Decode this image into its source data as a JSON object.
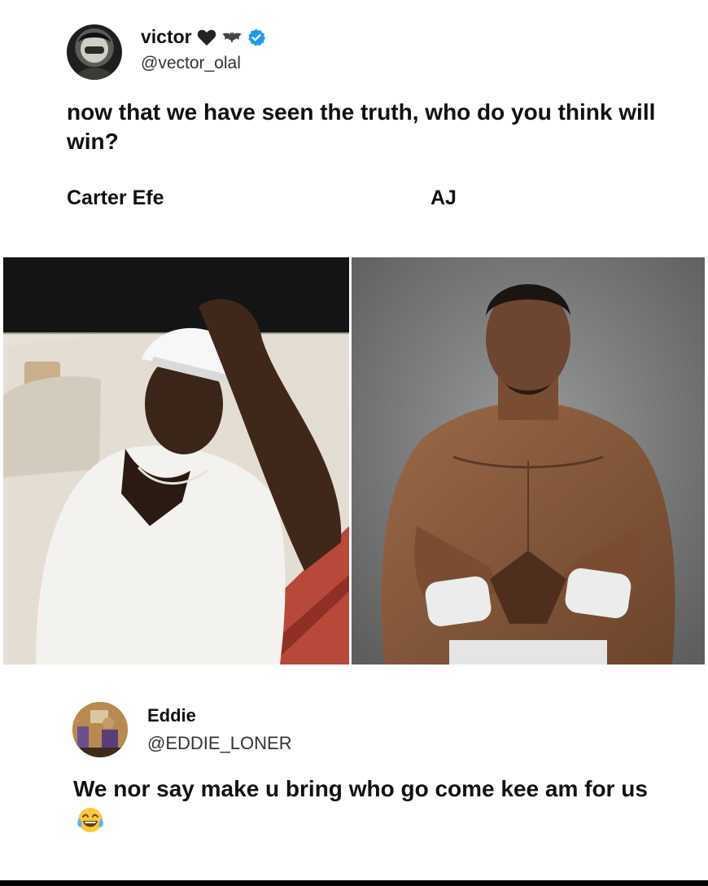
{
  "post": {
    "author_name": "victor",
    "author_handle": "@vector_olal",
    "text": "now that we have seen the truth, who do you think will win?",
    "option_left": "Carter Efe",
    "option_right": "AJ"
  },
  "reply": {
    "author_name": "Eddie",
    "author_handle": "@EDDIE_LONER",
    "text": "We nor say make u bring who go come kee am for us"
  },
  "icons": {
    "heart": "black-heart-icon",
    "bat": "bat-icon",
    "verified": "verified-badge-icon",
    "laugh": "tears-of-joy-emoji-icon"
  },
  "colors": {
    "verified": "#1d9bf0",
    "emoji_face": "#f9c93c"
  }
}
